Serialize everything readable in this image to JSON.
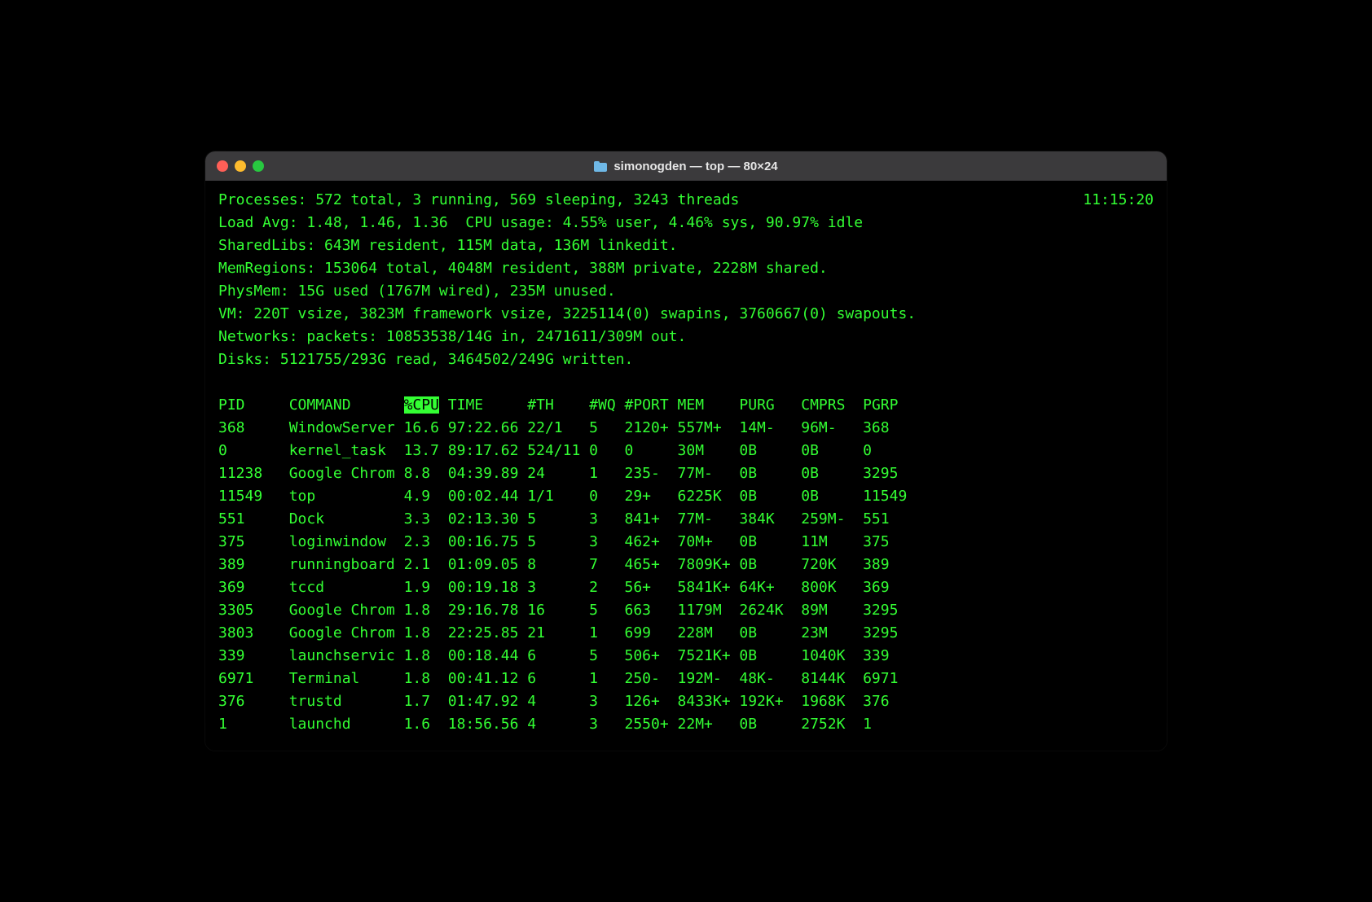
{
  "window": {
    "title": "simonogden — top — 80×24"
  },
  "summary": {
    "processes_line_left": "Processes: 572 total, 3 running, 569 sleeping, 3243 threads",
    "clock": "11:15:20",
    "load_cpu": "Load Avg: 1.48, 1.46, 1.36  CPU usage: 4.55% user, 4.46% sys, 90.97% idle",
    "sharedlibs": "SharedLibs: 643M resident, 115M data, 136M linkedit.",
    "memregions": "MemRegions: 153064 total, 4048M resident, 388M private, 2228M shared.",
    "physmem": "PhysMem: 15G used (1767M wired), 235M unused.",
    "vm": "VM: 220T vsize, 3823M framework vsize, 3225114(0) swapins, 3760667(0) swapouts.",
    "networks": "Networks: packets: 10853538/14G in, 2471611/309M out.",
    "disks": "Disks: 5121755/293G read, 3464502/249G written."
  },
  "headers": {
    "pid": "PID",
    "command": "COMMAND",
    "cpu": "%CPU",
    "time": "TIME",
    "th": "#TH",
    "wq": "#WQ",
    "port": "#PORT",
    "mem": "MEM",
    "purg": "PURG",
    "cmprs": "CMPRS",
    "pgrp": "PGRP"
  },
  "rows": [
    {
      "pid": "368",
      "command": "WindowServer",
      "cpu": "16.6",
      "time": "97:22.66",
      "th": "22/1",
      "wq": "5",
      "port": "2120+",
      "mem": "557M+",
      "purg": "14M-",
      "cmprs": "96M-",
      "pgrp": "368"
    },
    {
      "pid": "0",
      "command": "kernel_task",
      "cpu": "13.7",
      "time": "89:17.62",
      "th": "524/11",
      "wq": "0",
      "port": "0",
      "mem": "30M",
      "purg": "0B",
      "cmprs": "0B",
      "pgrp": "0"
    },
    {
      "pid": "11238",
      "command": "Google Chrom",
      "cpu": "8.8",
      "time": "04:39.89",
      "th": "24",
      "wq": "1",
      "port": "235-",
      "mem": "77M-",
      "purg": "0B",
      "cmprs": "0B",
      "pgrp": "3295"
    },
    {
      "pid": "11549",
      "command": "top",
      "cpu": "4.9",
      "time": "00:02.44",
      "th": "1/1",
      "wq": "0",
      "port": "29+",
      "mem": "6225K",
      "purg": "0B",
      "cmprs": "0B",
      "pgrp": "11549"
    },
    {
      "pid": "551",
      "command": "Dock",
      "cpu": "3.3",
      "time": "02:13.30",
      "th": "5",
      "wq": "3",
      "port": "841+",
      "mem": "77M-",
      "purg": "384K",
      "cmprs": "259M-",
      "pgrp": "551"
    },
    {
      "pid": "375",
      "command": "loginwindow",
      "cpu": "2.3",
      "time": "00:16.75",
      "th": "5",
      "wq": "3",
      "port": "462+",
      "mem": "70M+",
      "purg": "0B",
      "cmprs": "11M",
      "pgrp": "375"
    },
    {
      "pid": "389",
      "command": "runningboard",
      "cpu": "2.1",
      "time": "01:09.05",
      "th": "8",
      "wq": "7",
      "port": "465+",
      "mem": "7809K+",
      "purg": "0B",
      "cmprs": "720K",
      "pgrp": "389"
    },
    {
      "pid": "369",
      "command": "tccd",
      "cpu": "1.9",
      "time": "00:19.18",
      "th": "3",
      "wq": "2",
      "port": "56+",
      "mem": "5841K+",
      "purg": "64K+",
      "cmprs": "800K",
      "pgrp": "369"
    },
    {
      "pid": "3305",
      "command": "Google Chrom",
      "cpu": "1.8",
      "time": "29:16.78",
      "th": "16",
      "wq": "5",
      "port": "663",
      "mem": "1179M",
      "purg": "2624K",
      "cmprs": "89M",
      "pgrp": "3295"
    },
    {
      "pid": "3803",
      "command": "Google Chrom",
      "cpu": "1.8",
      "time": "22:25.85",
      "th": "21",
      "wq": "1",
      "port": "699",
      "mem": "228M",
      "purg": "0B",
      "cmprs": "23M",
      "pgrp": "3295"
    },
    {
      "pid": "339",
      "command": "launchservic",
      "cpu": "1.8",
      "time": "00:18.44",
      "th": "6",
      "wq": "5",
      "port": "506+",
      "mem": "7521K+",
      "purg": "0B",
      "cmprs": "1040K",
      "pgrp": "339"
    },
    {
      "pid": "6971",
      "command": "Terminal",
      "cpu": "1.8",
      "time": "00:41.12",
      "th": "6",
      "wq": "1",
      "port": "250-",
      "mem": "192M-",
      "purg": "48K-",
      "cmprs": "8144K",
      "pgrp": "6971"
    },
    {
      "pid": "376",
      "command": "trustd",
      "cpu": "1.7",
      "time": "01:47.92",
      "th": "4",
      "wq": "3",
      "port": "126+",
      "mem": "8433K+",
      "purg": "192K+",
      "cmprs": "1968K",
      "pgrp": "376"
    },
    {
      "pid": "1",
      "command": "launchd",
      "cpu": "1.6",
      "time": "18:56.56",
      "th": "4",
      "wq": "3",
      "port": "2550+",
      "mem": "22M+",
      "purg": "0B",
      "cmprs": "2752K",
      "pgrp": "1"
    }
  ]
}
